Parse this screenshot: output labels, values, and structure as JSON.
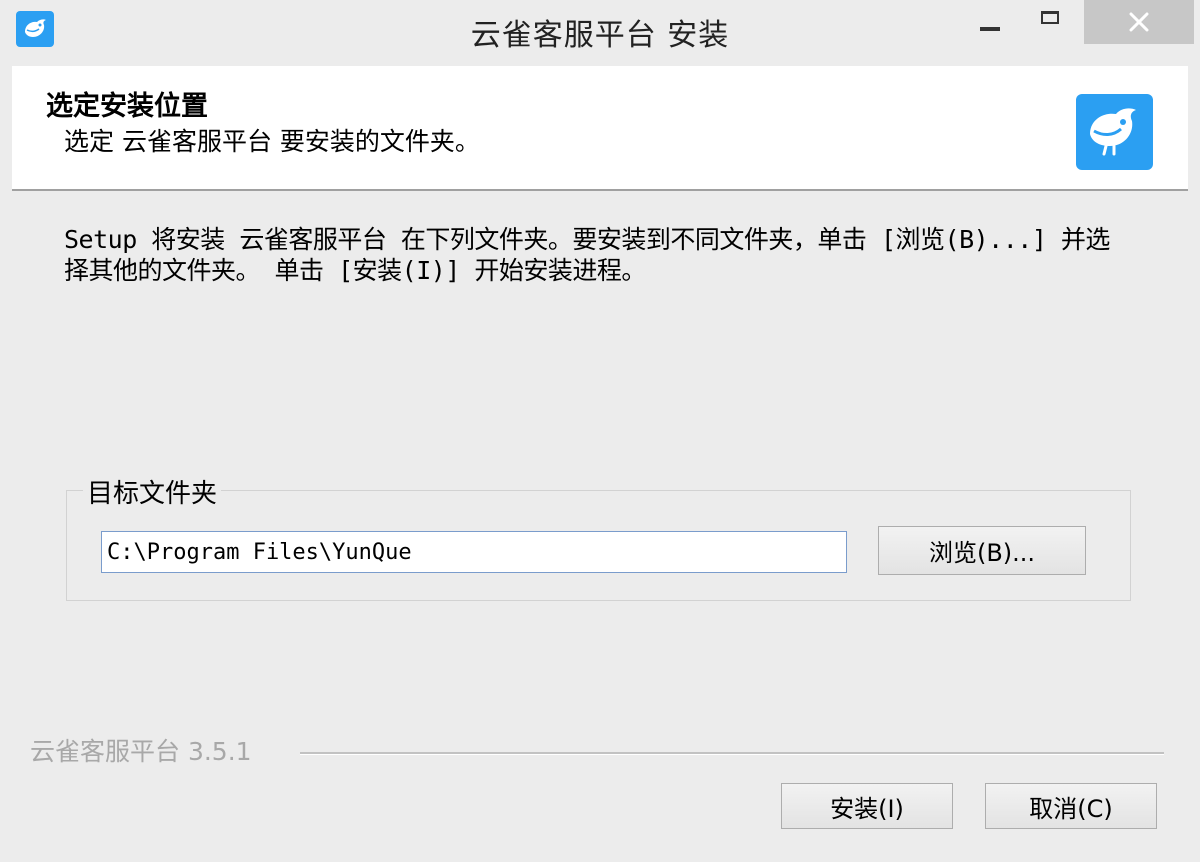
{
  "window": {
    "title": "云雀客服平台 安装",
    "icon": "bird-logo-icon",
    "controls": {
      "minimize_glyph": "",
      "maximize_glyph": "",
      "close_glyph": "✕"
    }
  },
  "header": {
    "title": "选定安装位置",
    "subtitle": "选定 云雀客服平台 要安装的文件夹。",
    "logo": "bird-logo-icon"
  },
  "instructions": "Setup 将安装 云雀客服平台 在下列文件夹。要安装到不同文件夹，单击 [浏览(B)...] 并选择其他的文件夹。 单击 [安装(I)] 开始安装进程。",
  "destination": {
    "group_label": "目标文件夹",
    "path_value": "C:\\Program Files\\YunQue",
    "browse_label": "浏览(B)..."
  },
  "footer": {
    "brand_version": "云雀客服平台 3.5.1",
    "install_label": "安装(I)",
    "cancel_label": "取消(C)"
  },
  "colors": {
    "accent": "#2b9ff2",
    "window_bg": "#ececec",
    "header_bg": "#ffffff",
    "disabled_text": "#a8a8a8"
  }
}
